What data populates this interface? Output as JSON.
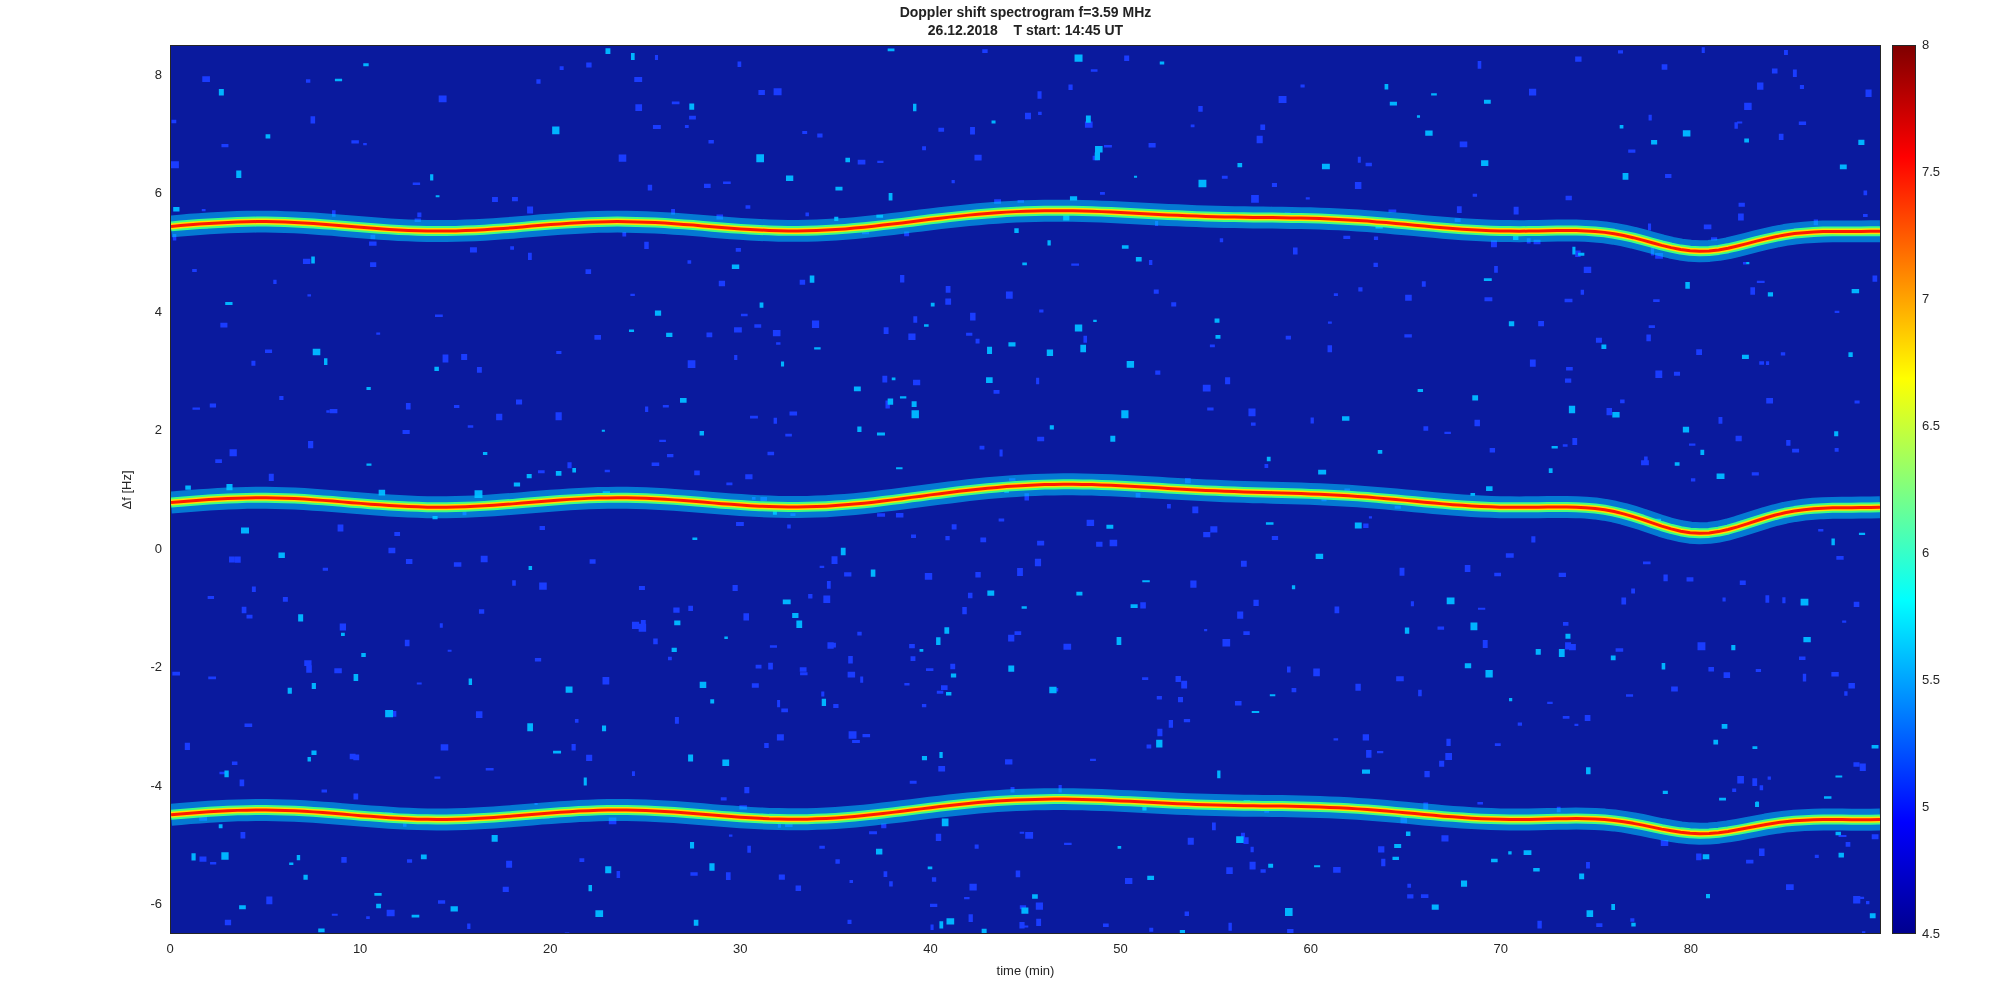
{
  "title": "Doppler shift spectrogram f=3.59 MHz",
  "subtitle": "26.12.2018    T start: 14:45 UT",
  "xlabel": "time (min)",
  "ylabel": "Δf [Hz]",
  "xticks": [
    "0",
    "10",
    "20",
    "30",
    "40",
    "50",
    "60",
    "70",
    "80"
  ],
  "yticks": [
    "8",
    "6",
    "4",
    "2",
    "0",
    "-2",
    "-4",
    "-6"
  ],
  "colorbar_ticks": [
    "8",
    "7.5",
    "7",
    "6.5",
    "6",
    "5.5",
    "5",
    "4.5"
  ]
}
